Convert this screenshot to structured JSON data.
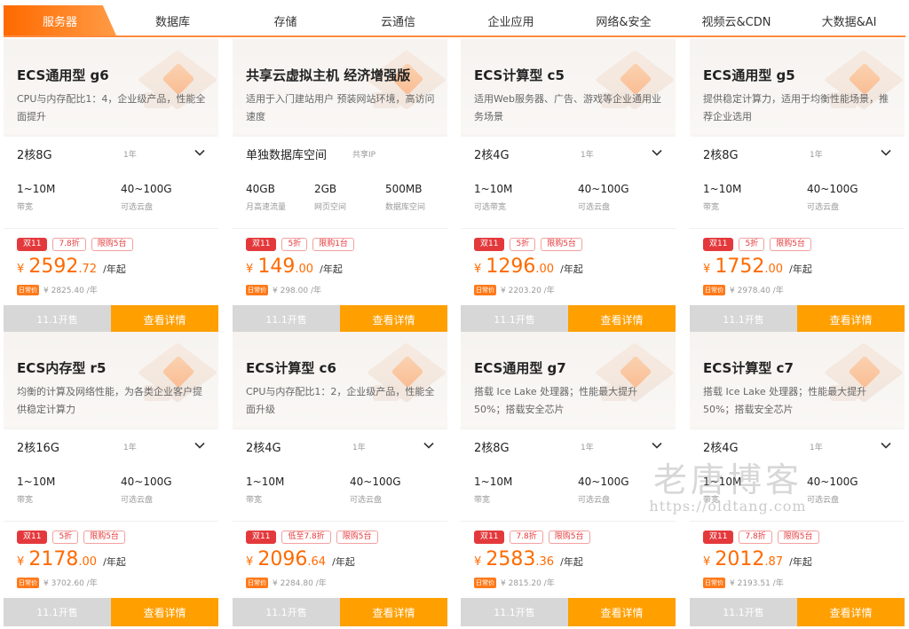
{
  "tabs": [
    "服务器",
    "数据库",
    "存储",
    "云通信",
    "企业应用",
    "网络&安全",
    "视频云&CDN",
    "大数据&AI"
  ],
  "active_tab": 0,
  "colors": {
    "accent": "#ff6a00",
    "price": "#ff6a00",
    "detail_button": "#ff9f00",
    "start_button": "#d7d7d7",
    "badge_red": "#e4393c"
  },
  "button_labels": {
    "start": "11.1开售",
    "detail": "查看详情"
  },
  "orig_label": "日常价",
  "currency": "¥",
  "cards": [
    {
      "title": "ECS通用型 g6",
      "desc": "CPU与内存配比1：4，企业级产品，性能全面提升",
      "config": "2核8G",
      "period": "1年",
      "has_dropdown": true,
      "specs": [
        {
          "value": "1~10M",
          "label": "带宽"
        },
        {
          "value": "40~100G",
          "label": "可选云盘"
        }
      ],
      "badges": [
        "双11",
        "7.8折",
        "限购5台"
      ],
      "price_int": "2592",
      "price_dec": ".72",
      "price_unit": "/年起",
      "orig": "¥ 2825.40 /年"
    },
    {
      "title": "共享云虚拟主机 经济增强版",
      "desc": "适用于入门建站用户 预装网站环境，高访问速度",
      "config": "单独数据库空间",
      "period": "共享IP",
      "has_dropdown": false,
      "specs": [
        {
          "value": "40GB",
          "label": "月高速流量"
        },
        {
          "value": "2GB",
          "label": "网页空间"
        },
        {
          "value": "500MB",
          "label": "数据库空间"
        }
      ],
      "badges": [
        "双11",
        "5折",
        "限购1台"
      ],
      "price_int": "149",
      "price_dec": ".00",
      "price_unit": "/年起",
      "orig": "¥ 298.00 /年"
    },
    {
      "title": "ECS计算型 c5",
      "desc": "适用Web服务器、广告、游戏等企业通用业务场景",
      "config": "2核4G",
      "period": "1年",
      "has_dropdown": true,
      "specs": [
        {
          "value": "1~10M",
          "label": "可选带宽"
        },
        {
          "value": "40~100G",
          "label": "可选云盘"
        }
      ],
      "badges": [
        "双11",
        "5折",
        "限购5台"
      ],
      "price_int": "1296",
      "price_dec": ".00",
      "price_unit": "/年起",
      "orig": "¥ 2203.20 /年"
    },
    {
      "title": "ECS通用型 g5",
      "desc": "提供稳定计算力，适用于均衡性能场景，推荐企业选用",
      "config": "2核8G",
      "period": "1年",
      "has_dropdown": true,
      "specs": [
        {
          "value": "1~10M",
          "label": "带宽"
        },
        {
          "value": "40~100G",
          "label": "可选云盘"
        }
      ],
      "badges": [
        "双11",
        "5折",
        "限购5台"
      ],
      "price_int": "1752",
      "price_dec": ".00",
      "price_unit": "/年起",
      "orig": "¥ 2978.40 /年"
    },
    {
      "title": "ECS内存型 r5",
      "desc": "均衡的计算及网络性能，为各类企业客户提供稳定计算力",
      "config": "2核16G",
      "period": "1年",
      "has_dropdown": true,
      "specs": [
        {
          "value": "1~10M",
          "label": "带宽"
        },
        {
          "value": "40~100G",
          "label": "可选云盘"
        }
      ],
      "badges": [
        "双11",
        "5折",
        "限购5台"
      ],
      "price_int": "2178",
      "price_dec": ".00",
      "price_unit": "/年起",
      "orig": "¥ 3702.60 /年"
    },
    {
      "title": "ECS计算型 c6",
      "desc": "CPU与内存配比1：2，企业级产品，性能全面升级",
      "config": "2核4G",
      "period": "1年",
      "has_dropdown": true,
      "specs": [
        {
          "value": "1~10M",
          "label": "带宽"
        },
        {
          "value": "40~100G",
          "label": "可选云盘"
        }
      ],
      "badges": [
        "双11",
        "低至7.8折",
        "限购5台"
      ],
      "price_int": "2096",
      "price_dec": ".64",
      "price_unit": "/年起",
      "orig": "¥ 2284.80 /年"
    },
    {
      "title": "ECS通用型 g7",
      "desc": "搭载 Ice Lake 处理器；性能最大提升50%；搭载安全芯片",
      "config": "2核8G",
      "period": "1年",
      "has_dropdown": true,
      "specs": [
        {
          "value": "1~10M",
          "label": "带宽"
        },
        {
          "value": "40~100G",
          "label": "可选云盘"
        }
      ],
      "badges": [
        "双11",
        "7.8折",
        "限购5台"
      ],
      "price_int": "2583",
      "price_dec": ".36",
      "price_unit": "/年起",
      "orig": "¥ 2815.20 /年"
    },
    {
      "title": "ECS计算型 c7",
      "desc": "搭载 Ice Lake 处理器；性能最大提升50%；搭载安全芯片",
      "config": "2核4G",
      "period": "1年",
      "has_dropdown": true,
      "specs": [
        {
          "value": "1~10M",
          "label": "带宽"
        },
        {
          "value": "40~100G",
          "label": "可选云盘"
        }
      ],
      "badges": [
        "双11",
        "7.8折",
        "限购5台"
      ],
      "price_int": "2012",
      "price_dec": ".87",
      "price_unit": "/年起",
      "orig": "¥ 2193.51 /年"
    }
  ],
  "watermark": {
    "text": "老唐博客",
    "url": "https://oldtang.com"
  }
}
